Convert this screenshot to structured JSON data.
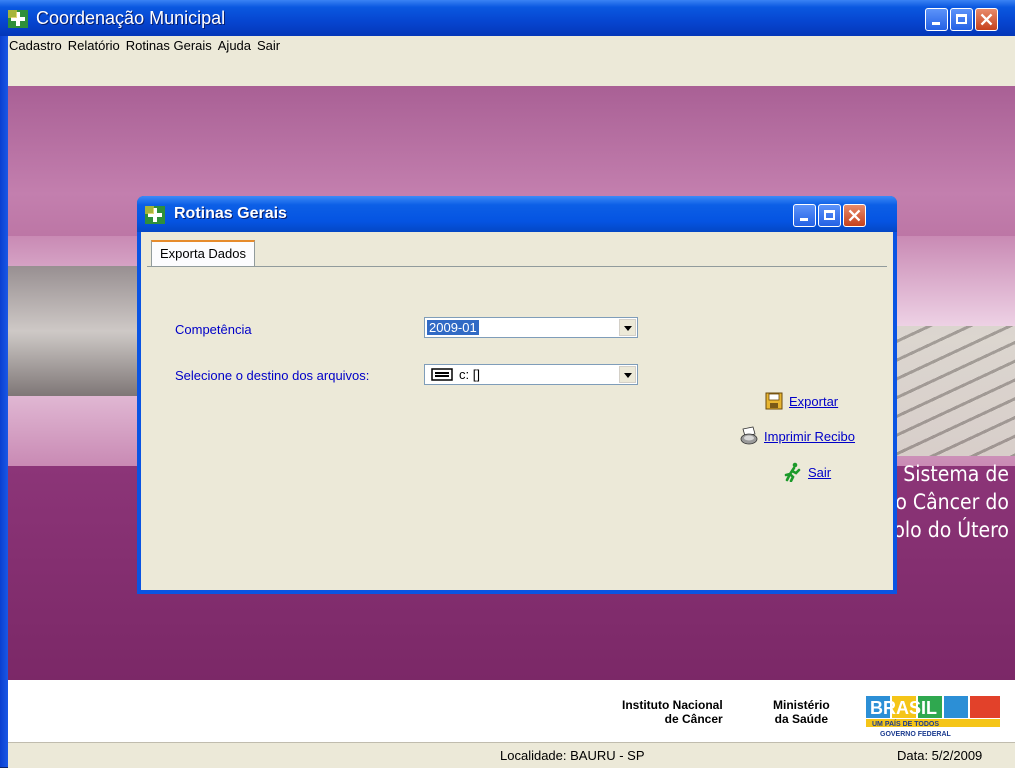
{
  "main_window": {
    "title": "Coordenação Municipal",
    "menu": [
      "Cadastro",
      "Relatório",
      "Rotinas Gerais",
      "Ajuda",
      "Sair"
    ]
  },
  "background": {
    "system_title_lines": [
      "Sistema de",
      "Informação do Câncer do",
      "Colo do Útero"
    ]
  },
  "logos": {
    "inca_line1": "Instituto Nacional",
    "inca_line2": "de Câncer",
    "ms_line1": "Ministério",
    "ms_line2": "da Saúde",
    "brasil": "BRASIL",
    "brasil_tagline": "UM PAÍS DE TODOS",
    "brasil_gov": "GOVERNO FEDERAL"
  },
  "statusbar": {
    "locality": "Localidade: BAURU - SP",
    "date": "Data: 5/2/2009"
  },
  "dialog": {
    "title": "Rotinas Gerais",
    "tab_label": "Exporta Dados",
    "competencia_label": "Competência",
    "competencia_value": "2009-01",
    "destino_label": "Selecione o destino dos arquivos:",
    "destino_value": "c: []",
    "actions": {
      "exportar": "Exportar",
      "imprimir": "Imprimir Recibo",
      "sair": "Sair"
    }
  },
  "colors": {
    "xp_blue": "#0554e2",
    "dialog_face": "#ece9d8",
    "label_blue": "#0000c8",
    "background_magenta": "#8a3373"
  },
  "icons": {
    "app": "datasus-cross-icon",
    "export": "floppy-disk-icon",
    "print": "printer-icon",
    "exit": "running-man-icon",
    "drive": "drive-icon"
  }
}
